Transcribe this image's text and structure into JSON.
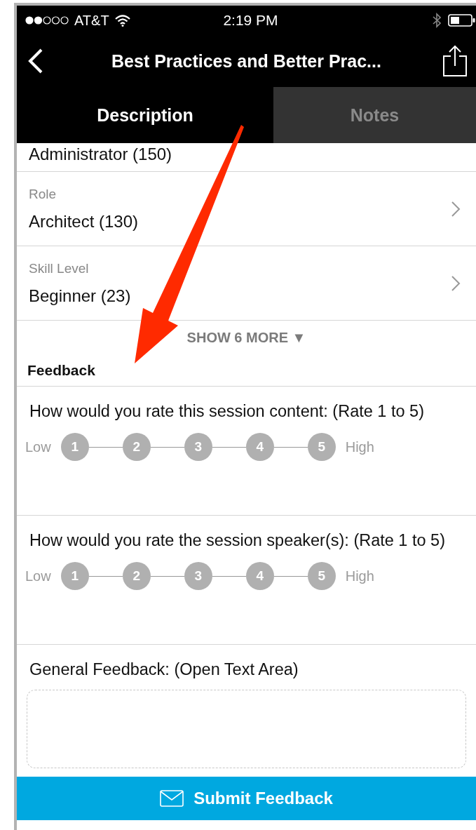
{
  "status_bar": {
    "carrier": "AT&T",
    "time": "2:19 PM"
  },
  "nav": {
    "title": "Best Practices and Better Prac..."
  },
  "tabs": [
    {
      "label": "Description",
      "selected": true
    },
    {
      "label": "Notes",
      "selected": false
    }
  ],
  "filters": [
    {
      "value": "Administrator (150)"
    },
    {
      "label": "Role",
      "value": "Architect (130)"
    },
    {
      "label": "Skill Level",
      "value": "Beginner (23)"
    }
  ],
  "show_more": {
    "label": "SHOW 6 MORE",
    "caret": "▼"
  },
  "feedback": {
    "heading": "Feedback",
    "questions": [
      {
        "text": "How would you rate this session content: (Rate 1 to 5)",
        "low": "Low",
        "high": "High",
        "options": [
          {
            "label": "1",
            "selected": false
          },
          {
            "label": "2",
            "selected": false
          },
          {
            "label": "3",
            "selected": false
          },
          {
            "label": "4",
            "selected": false
          },
          {
            "label": "5",
            "selected": false
          }
        ]
      },
      {
        "text": "How would you rate the session speaker(s): (Rate 1 to 5)",
        "low": "Low",
        "high": "High",
        "options": [
          {
            "label": "1",
            "selected": false
          },
          {
            "label": "2",
            "selected": false
          },
          {
            "label": "3",
            "selected": false
          },
          {
            "label": "4",
            "selected": false
          },
          {
            "label": "5",
            "selected": false
          }
        ]
      }
    ],
    "general": {
      "label": "General Feedback: (Open Text Area)"
    },
    "submit": "Submit Feedback"
  }
}
